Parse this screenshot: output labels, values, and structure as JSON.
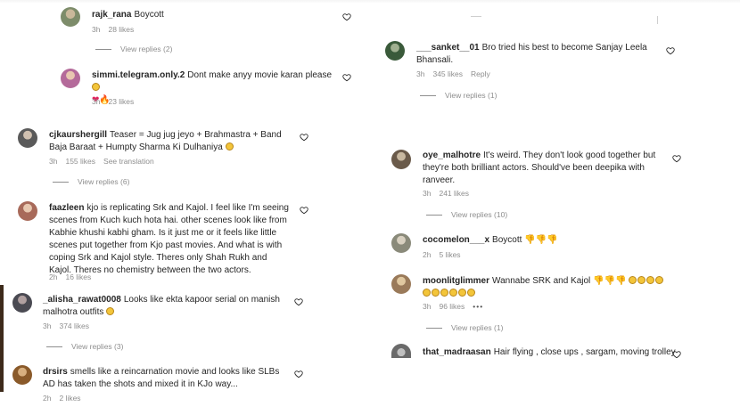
{
  "left_comments": [
    {
      "user": "rajk_rana",
      "text": "Boycott",
      "time": "3h",
      "likes": "28 likes",
      "action": "",
      "replies": "View replies (2)",
      "avatar_color": "#7d8c6a"
    },
    {
      "user": "simmi.telegram.only.2",
      "text": "Dont make anyy movie karan please",
      "text2": "",
      "time": "3h",
      "likes": "23 likes",
      "action": "",
      "replies": "",
      "avatar_color": "#b46a9a"
    },
    {
      "user": "cjkaurshergill",
      "text": "Teaser = Jug jug jeyo + Brahmastra + Band Baja Baraat + Humpty Sharma Ki Dulhaniya",
      "time": "3h",
      "likes": "155 likes",
      "action": "See translation",
      "replies": "View replies (6)",
      "avatar_color": "#5a5a5a"
    },
    {
      "user": "faazleen",
      "text": "kjo is replicating Srk and Kajol. I feel like I'm seeing scenes from Kuch kuch hota hai. other scenes look like from Kabhie khushi kabhi gham. Is it just me or it feels like little scenes put together from Kjo past movies. And what is with coping Srk and Kajol style. Theres only Shah Rukh and Kajol. Theres no chemistry between the two actors.",
      "time": "2h",
      "likes": "16 likes",
      "action": "",
      "replies": "",
      "avatar_color": "#a86a5a"
    },
    {
      "user": "_alisha_rawat0008",
      "text": "Looks like ekta kapoor serial on manish malhotra outfits",
      "time": "3h",
      "likes": "374 likes",
      "action": "",
      "replies": "View replies (3)",
      "avatar_color": "#4a4a52"
    },
    {
      "user": "drsirs",
      "text": "smells like a reincarnation movie and looks like SLBs AD has taken the shots and mixed it in KJo way...",
      "time": "2h",
      "likes": "2 likes",
      "action": "",
      "replies": "",
      "avatar_color": "#8a5a2a"
    }
  ],
  "right_comments": [
    {
      "user": "___sanket__01",
      "text": "Bro tried his best to become Sanjay Leela Bhansali.",
      "time": "3h",
      "likes": "345 likes",
      "action": "Reply",
      "replies": "View replies (1)",
      "avatar_color": "#3a5a3a"
    },
    {
      "user": "oye_malhotre",
      "text": "It's weird. They don't look good together but they're both brilliant actors. Should've been deepika with ranveer.",
      "time": "3h",
      "likes": "241 likes",
      "action": "",
      "replies": "View replies (10)",
      "avatar_color": "#6a5a4a"
    },
    {
      "user": "cocomelon___x",
      "text": "Boycott",
      "time": "2h",
      "likes": "5 likes",
      "action": "",
      "replies": "",
      "avatar_color": "#8a8a7a"
    },
    {
      "user": "moonlitglimmer",
      "text": "Wannabe SRK and Kajol",
      "time": "3h",
      "likes": "96 likes",
      "action": "•••",
      "replies": "View replies (1)",
      "avatar_color": "#9a7a5a"
    },
    {
      "user": "that_madraasan",
      "text": "Hair flying , close ups , sargam, moving trolley",
      "time": "",
      "likes": "",
      "action": "",
      "replies": "",
      "avatar_color": "#6a6a6a"
    }
  ],
  "colors": {
    "text": "#262626",
    "meta": "#8e8e8e",
    "background": "#ffffff"
  },
  "icons": {
    "like": "heart-outline-icon"
  }
}
